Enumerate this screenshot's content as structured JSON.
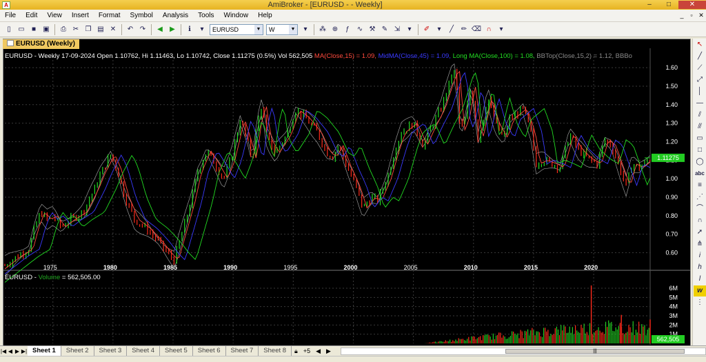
{
  "window": {
    "title": "AmiBroker - [EURUSD -  - Weekly]",
    "min": "–",
    "max": "□",
    "close": "✕"
  },
  "menu": [
    "File",
    "Edit",
    "View",
    "Insert",
    "Format",
    "Symbol",
    "Analysis",
    "Tools",
    "Window",
    "Help"
  ],
  "toolbar": {
    "symbol": "EURUSD",
    "interval": "W"
  },
  "chart_tab": "EURUSD (Weekly)",
  "legend": [
    {
      "text": "EURUSD - Weekly 17-09-2024 Open 1.10762, Hi 1.11463, Lo 1.10742, Close 1.11275 (0.5%) Vol 562,505 ",
      "color": "#ffffff"
    },
    {
      "text": "MA(Close,15) = 1.09, ",
      "color": "#ff4a3d"
    },
    {
      "text": "MidMA(Close,45) = 1.09, ",
      "color": "#3a3aff"
    },
    {
      "text": "Long MA(Close,100) = 1.08, ",
      "color": "#22dd22"
    },
    {
      "text": "BBTop(Close,15,2) = 1.12, ",
      "color": "#8a8a8a"
    },
    {
      "text": "BBBo",
      "color": "#8a8a8a"
    }
  ],
  "volume_legend": {
    "prefix": "EURUSD - ",
    "label": "Volume",
    "value": " = 562,505.00",
    "label_color": "#22aa22"
  },
  "sheets": [
    "Sheet 1",
    "Sheet 2",
    "Sheet 3",
    "Sheet 4",
    "Sheet 5",
    "Sheet 6",
    "Sheet 7",
    "Sheet 8"
  ],
  "chart_data": {
    "type": "line",
    "price_axis": {
      "ticks": [
        "0.60",
        "0.70",
        "0.80",
        "0.90",
        "1.00",
        "1.10",
        "1.20",
        "1.30",
        "1.40",
        "1.50",
        "1.60"
      ],
      "range": [
        0.52,
        1.66
      ]
    },
    "x_ticks": [
      "1975",
      "1980",
      "1985",
      "1990",
      "1995",
      "2000",
      "2005",
      "2010",
      "2015",
      "2020"
    ],
    "bold_x_ticks": [
      "1980",
      "1985",
      "1990",
      "2000",
      "2010",
      "2015",
      "2020"
    ],
    "last_price": "1.11275",
    "last_price_color": "#22cc22",
    "volume_axis": {
      "ticks": [
        "1M",
        "2M",
        "3M",
        "4M",
        "5M",
        "6M"
      ],
      "range": [
        0,
        7.2
      ]
    },
    "last_volume": "562,505",
    "x_range": [
      1971,
      2024.7
    ],
    "price_path": [
      [
        1971.0,
        0.53
      ],
      [
        1972.0,
        0.58
      ],
      [
        1973.0,
        0.62
      ],
      [
        1973.5,
        0.74
      ],
      [
        1974.0,
        0.82
      ],
      [
        1974.5,
        0.78
      ],
      [
        1975.0,
        0.8
      ],
      [
        1975.7,
        0.74
      ],
      [
        1976.5,
        0.78
      ],
      [
        1977.5,
        0.82
      ],
      [
        1978.5,
        0.95
      ],
      [
        1979.0,
        1.03
      ],
      [
        1979.8,
        1.13
      ],
      [
        1980.3,
        1.06
      ],
      [
        1981.0,
        0.9
      ],
      [
        1981.8,
        0.78
      ],
      [
        1982.8,
        0.73
      ],
      [
        1983.8,
        0.66
      ],
      [
        1984.5,
        0.6
      ],
      [
        1985.1,
        0.56
      ],
      [
        1985.8,
        0.72
      ],
      [
        1986.5,
        0.88
      ],
      [
        1987.0,
        1.03
      ],
      [
        1987.8,
        1.15
      ],
      [
        1988.5,
        1.08
      ],
      [
        1989.2,
        1.0
      ],
      [
        1989.8,
        1.1
      ],
      [
        1990.6,
        1.32
      ],
      [
        1991.2,
        1.2
      ],
      [
        1991.6,
        1.1
      ],
      [
        1992.0,
        1.3
      ],
      [
        1992.4,
        1.4
      ],
      [
        1992.8,
        1.22
      ],
      [
        1993.5,
        1.14
      ],
      [
        1994.5,
        1.24
      ],
      [
        1995.2,
        1.37
      ],
      [
        1996.0,
        1.33
      ],
      [
        1997.0,
        1.25
      ],
      [
        1997.8,
        1.14
      ],
      [
        1998.3,
        1.12
      ],
      [
        1998.8,
        1.18
      ],
      [
        1999.5,
        1.06
      ],
      [
        2000.2,
        0.96
      ],
      [
        2000.8,
        0.84
      ],
      [
        2001.5,
        0.9
      ],
      [
        2002.0,
        0.88
      ],
      [
        2002.8,
        1.0
      ],
      [
        2003.5,
        1.16
      ],
      [
        2004.0,
        1.25
      ],
      [
        2005.0,
        1.3
      ],
      [
        2005.8,
        1.18
      ],
      [
        2006.5,
        1.28
      ],
      [
        2007.3,
        1.38
      ],
      [
        2008.2,
        1.56
      ],
      [
        2008.5,
        1.58
      ],
      [
        2008.9,
        1.26
      ],
      [
        2009.3,
        1.32
      ],
      [
        2009.8,
        1.5
      ],
      [
        2010.4,
        1.21
      ],
      [
        2011.2,
        1.44
      ],
      [
        2011.8,
        1.3
      ],
      [
        2012.5,
        1.22
      ],
      [
        2013.0,
        1.32
      ],
      [
        2014.1,
        1.38
      ],
      [
        2014.8,
        1.25
      ],
      [
        2015.2,
        1.08
      ],
      [
        2015.8,
        1.1
      ],
      [
        2016.6,
        1.08
      ],
      [
        2017.2,
        1.06
      ],
      [
        2018.0,
        1.24
      ],
      [
        2018.7,
        1.16
      ],
      [
        2019.5,
        1.11
      ],
      [
        2020.3,
        1.08
      ],
      [
        2020.9,
        1.21
      ],
      [
        2021.5,
        1.18
      ],
      [
        2022.2,
        1.05
      ],
      [
        2022.7,
        0.96
      ],
      [
        2023.2,
        1.08
      ],
      [
        2023.8,
        1.06
      ],
      [
        2024.7,
        1.11
      ]
    ],
    "volume_profile": [
      [
        1971,
        0
      ],
      [
        2006,
        0.02
      ],
      [
        2010,
        0.6
      ],
      [
        2014,
        1.1
      ],
      [
        2016,
        1.4
      ],
      [
        2018,
        1.6
      ],
      [
        2020,
        1.8
      ],
      [
        2022,
        1.9
      ],
      [
        2024.7,
        1.7
      ]
    ],
    "volume_spikes": [
      [
        2019.8,
        6.3
      ],
      [
        2022.3,
        3.1
      ],
      [
        2024.7,
        2.6
      ]
    ]
  }
}
